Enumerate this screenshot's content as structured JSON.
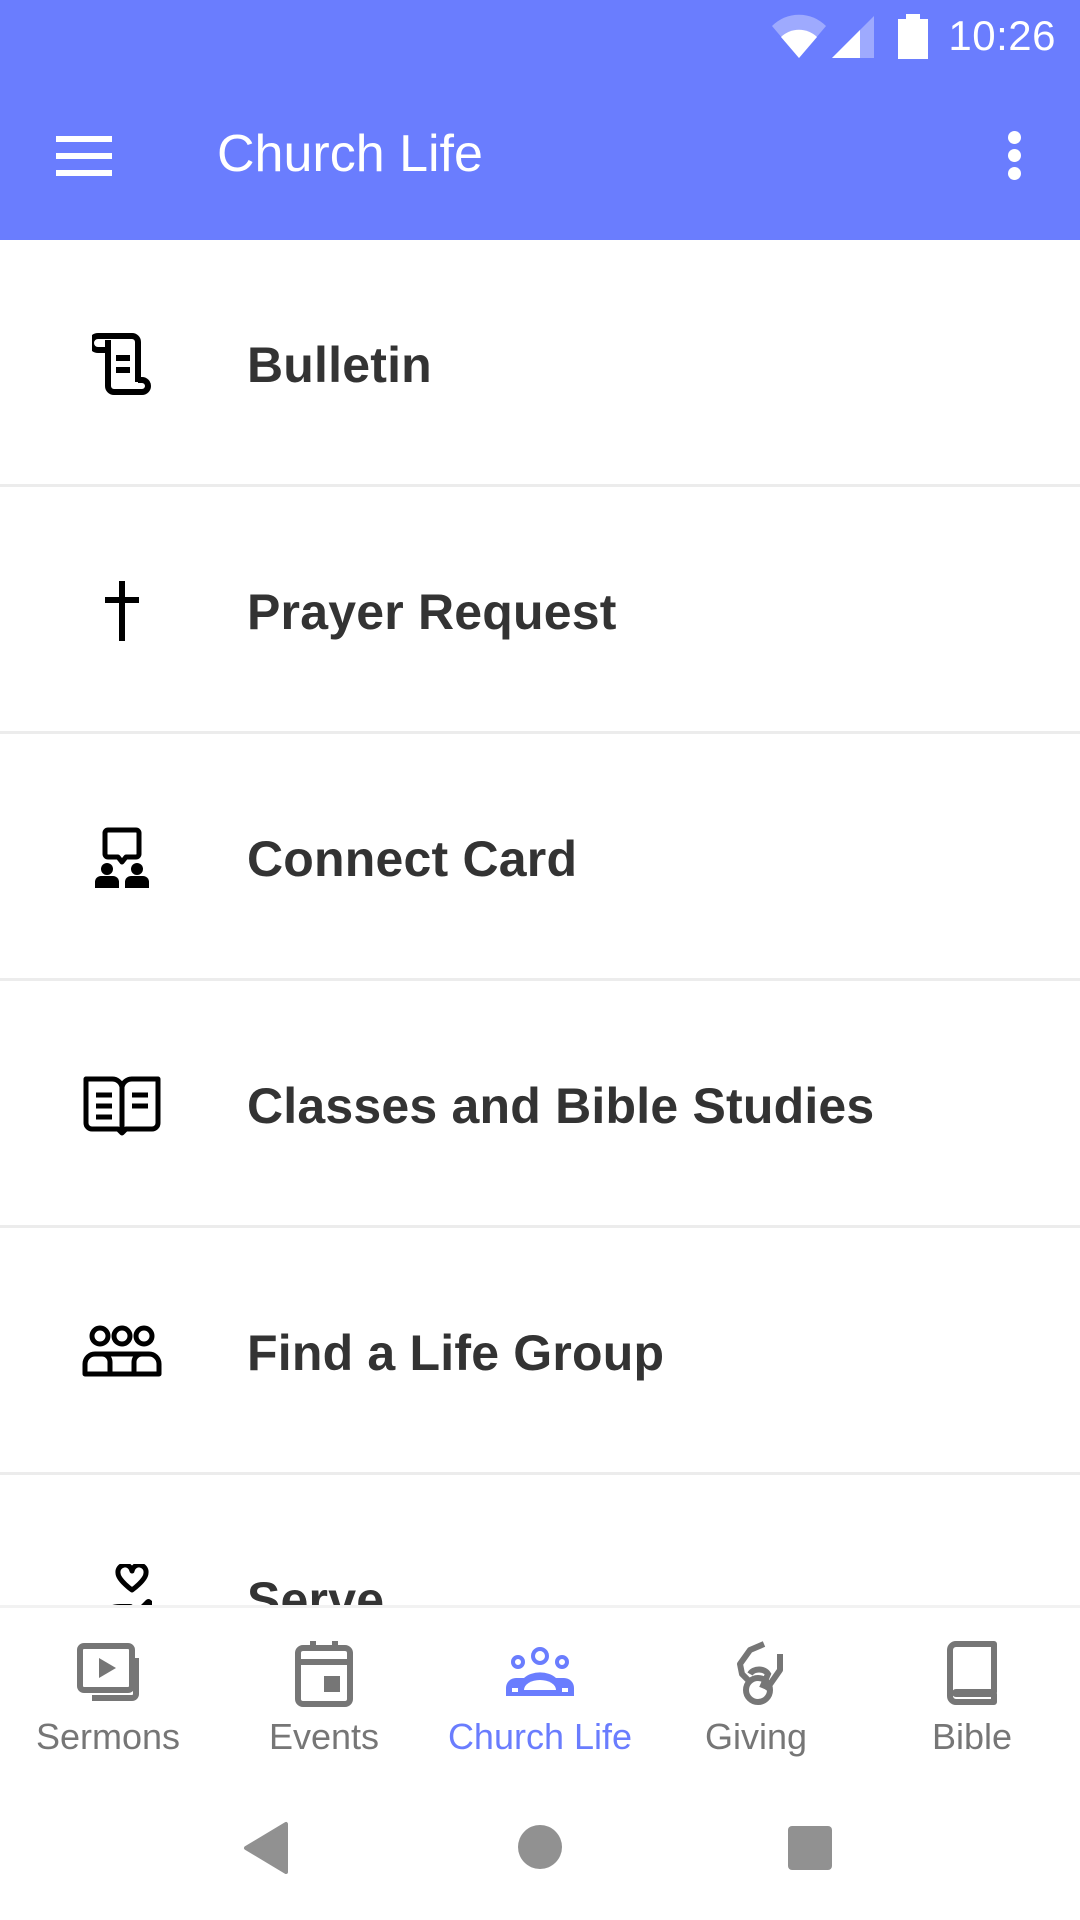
{
  "status_bar": {
    "time": "10:26",
    "icons": [
      "wifi-icon",
      "cell-signal-icon",
      "battery-icon"
    ]
  },
  "app_bar": {
    "title": "Church Life",
    "menu_icon": "hamburger-menu-icon",
    "overflow_icon": "more-vert-icon",
    "background_color": "#6a7dfe"
  },
  "list": {
    "items": [
      {
        "label": "Bulletin",
        "icon": "scroll-icon"
      },
      {
        "label": "Prayer Request",
        "icon": "cross-icon"
      },
      {
        "label": "Connect Card",
        "icon": "connect-people-icon"
      },
      {
        "label": "Classes and Bible Studies",
        "icon": "open-book-icon"
      },
      {
        "label": "Find a Life Group",
        "icon": "group-icon"
      },
      {
        "label": "Serve",
        "icon": "hand-heart-icon"
      }
    ]
  },
  "bottom_nav": {
    "active_index": 2,
    "active_color": "#6a7dfe",
    "inactive_color": "#767676",
    "items": [
      {
        "label": "Sermons",
        "icon": "video-library-icon"
      },
      {
        "label": "Events",
        "icon": "calendar-icon"
      },
      {
        "label": "Church Life",
        "icon": "people-icon"
      },
      {
        "label": "Giving",
        "icon": "giving-hand-icon"
      },
      {
        "label": "Bible",
        "icon": "book-icon"
      }
    ]
  },
  "system_nav": {
    "buttons": [
      "back",
      "home",
      "recents"
    ]
  }
}
